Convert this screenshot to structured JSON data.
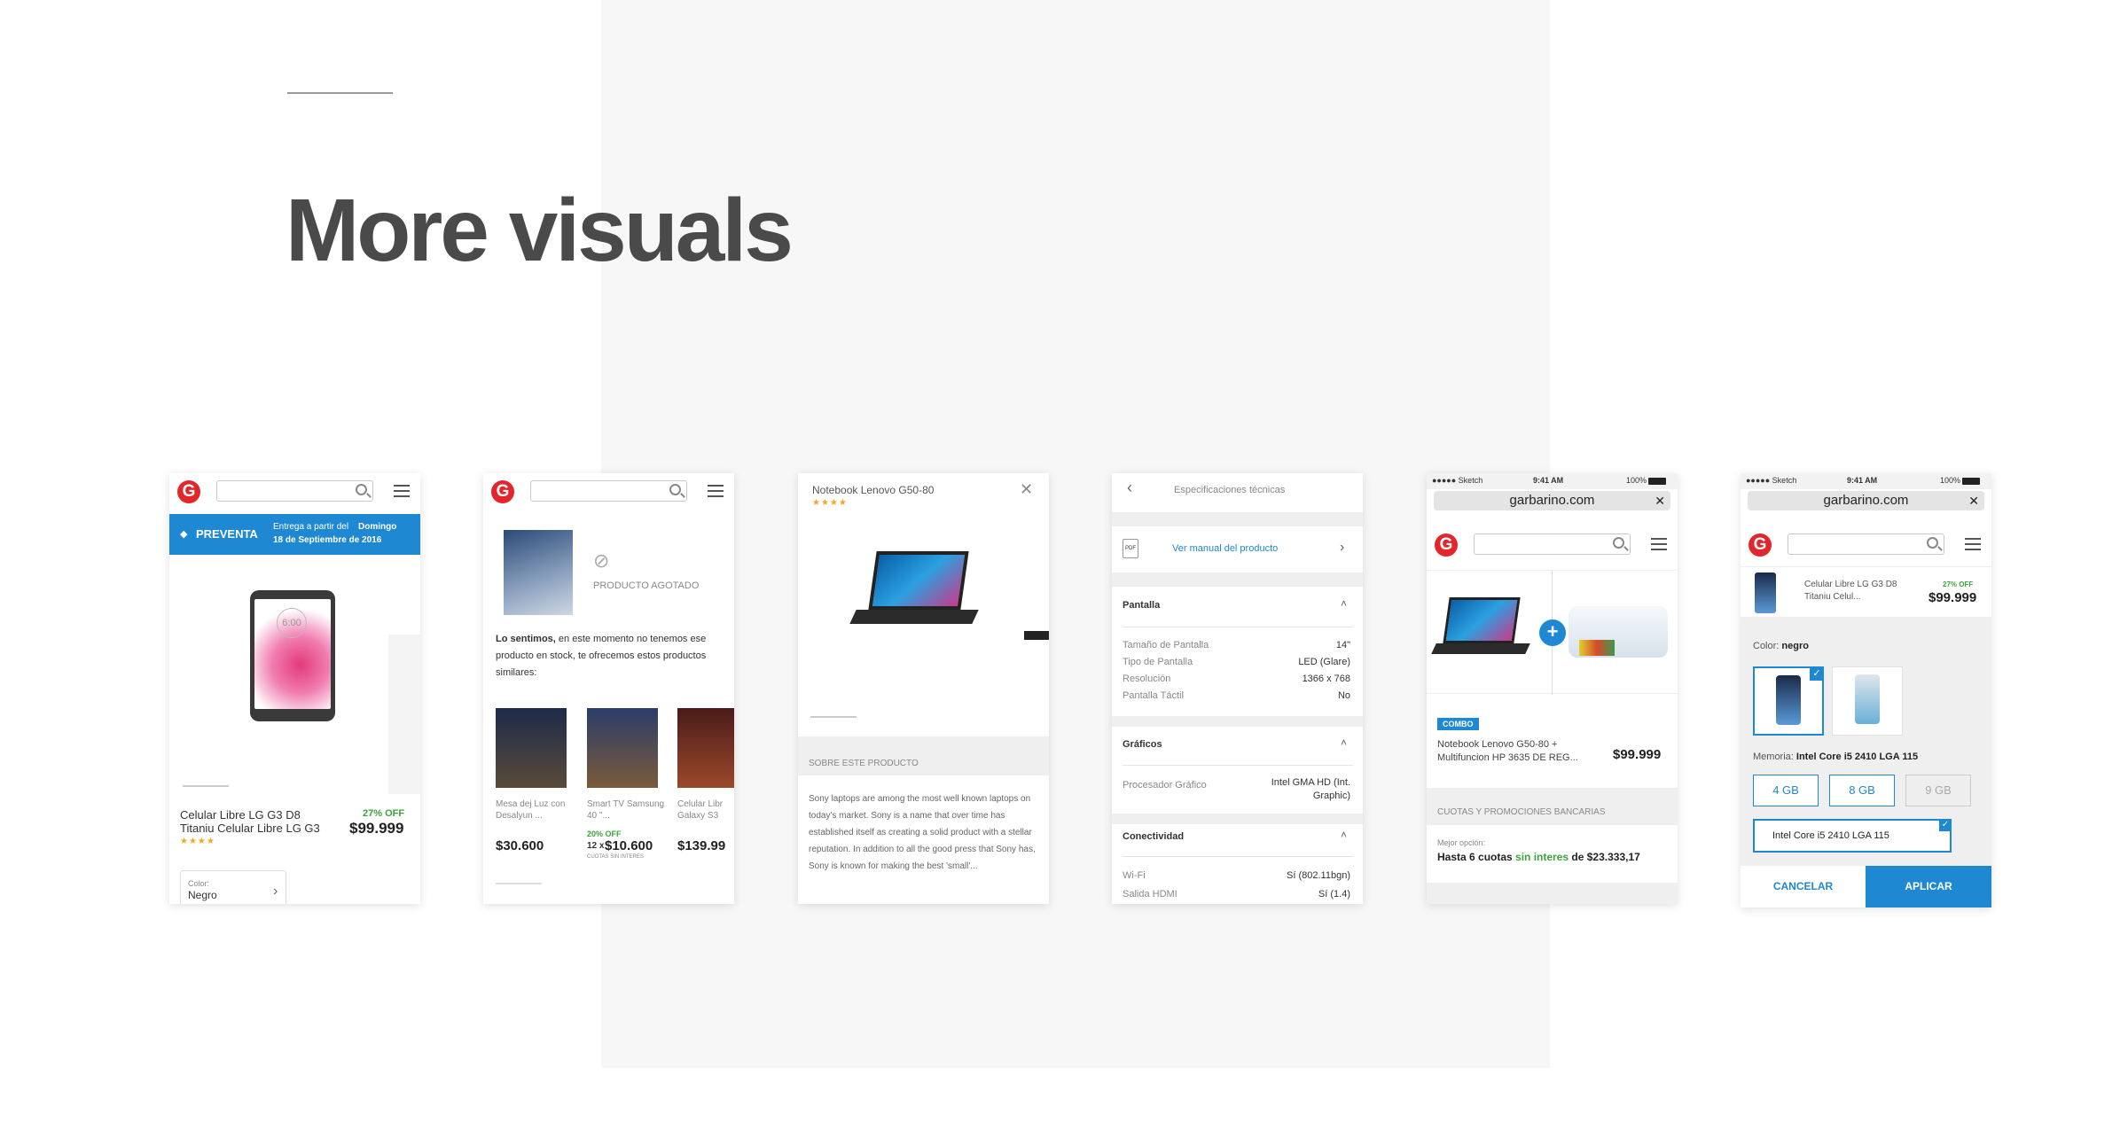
{
  "page": {
    "title": "More visuals"
  },
  "s1": {
    "preventa_label": "PREVENTA",
    "delivery_text": "Entrega a partir del",
    "delivery_day": "Domingo",
    "delivery_date": "18 de Septiembre de 2016",
    "phone_time": "6:00",
    "product_name_1": "Celular Libre LG G3 D8",
    "product_name_2": "Titaniu Celular Libre LG G3",
    "discount": "27% OFF",
    "price": "$99.999",
    "rating": "★★★★",
    "color_label": "Color:",
    "color_value": "Negro"
  },
  "s2": {
    "out_of_stock": "PRODUCTO AGOTADO",
    "sorry_bold": "Lo sentimos,",
    "sorry_text": "en este momento no tenemos ese producto en stock, te ofrecemos estos productos similares:",
    "items": [
      {
        "name": "Mesa dej Luz con Desalyun ...",
        "price": "$30.600"
      },
      {
        "name": "Smart TV Samsung 40 \"...",
        "discount": "20% OFF",
        "installments": "12 x",
        "price": "$10.600",
        "note": "CUOTAS SIN INTERES"
      },
      {
        "name": "Celular Libr Galaxy S3",
        "price": "$139.99"
      }
    ]
  },
  "s3": {
    "product_title": "Notebook Lenovo G50-80",
    "rating": "★★★★",
    "about_label": "SOBRE ESTE PRODUCTO",
    "description": "Sony laptops are among the most well known laptops on today's market. Sony is a name that over time has established itself as creating a solid product with a stellar reputation. In addition to all the good press that Sony has, Sony is known for making the best 'small'..."
  },
  "s4": {
    "header": "Especificaciones técnicas",
    "manual_link": "Ver manual del producto",
    "sections": [
      {
        "title": "Pantalla",
        "rows": [
          {
            "label": "Tamaño de Pantalla",
            "value": "14\""
          },
          {
            "label": "Tipo de Pantalla",
            "value": "LED (Glare)"
          },
          {
            "label": "Resolución",
            "value": "1366 x 768"
          },
          {
            "label": "Pantalla Táctil",
            "value": "No"
          }
        ]
      },
      {
        "title": "Gráficos",
        "rows": [
          {
            "label": "Procesador Gráfico",
            "value": "Intel GMA HD (Int. Graphic)"
          }
        ]
      },
      {
        "title": "Conectividad",
        "rows": [
          {
            "label": "Wi-Fi",
            "value": "Sí (802.11bgn)"
          },
          {
            "label": "Salida HDMI",
            "value": "Sí (1.4)"
          }
        ]
      }
    ]
  },
  "s5": {
    "status_left": "●●●●● Sketch",
    "status_time": "9:41 AM",
    "status_battery": "100%",
    "url": "garbarino.com",
    "combo_badge": "COMBO",
    "combo_line_1": "Notebook Lenovo G50-80 +",
    "combo_line_2": "Multifuncion HP 3635 DE REG...",
    "price": "$99.999",
    "banks_label": "CUOTAS Y PROMOCIONES BANCARIAS",
    "best_option": "Mejor opción:",
    "installments_prefix": "Hasta 6 cuotas",
    "installments_free": "sin interes",
    "installments_suffix": "de $23.333,17"
  },
  "s6": {
    "status_left": "●●●●● Sketch",
    "status_time": "9:41 AM",
    "status_battery": "100%",
    "url": "garbarino.com",
    "product_name_1": "Celular Libre LG G3 D8",
    "product_name_2": "Titaniu Celul...",
    "discount": "27% OFF",
    "price": "$99.999",
    "color_label": "Color:",
    "color_value": "negro",
    "memory_label": "Memoria:",
    "memory_value": "Intel Core i5 2410 LGA 115",
    "mem_options": [
      "4 GB",
      "8 GB",
      "9 GB"
    ],
    "select_value": "Intel Core i5 2410 LGA 115",
    "cancel": "CANCELAR",
    "apply": "APLICAR"
  },
  "colors": {
    "brand_red": "#e3262b",
    "accent_blue": "#1e88d2",
    "green": "#3aa53a",
    "star": "#f5a623"
  }
}
